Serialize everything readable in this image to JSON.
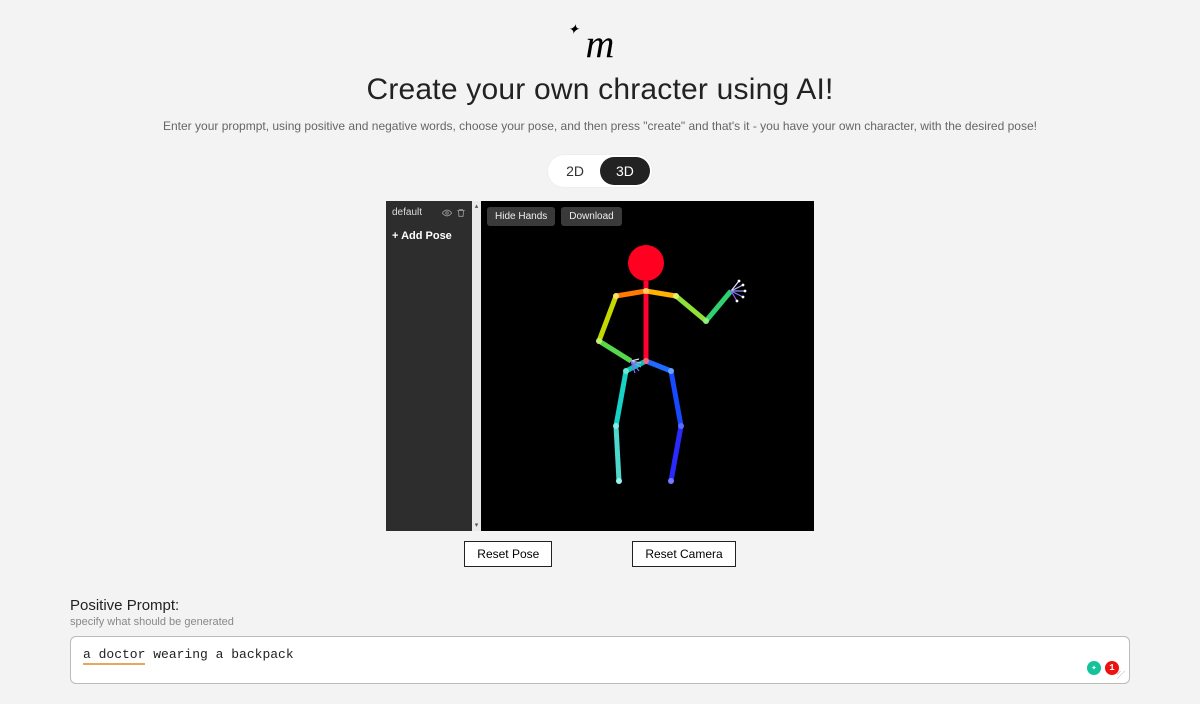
{
  "logo_text": "m",
  "title": "Create your own chracter using AI!",
  "subtitle": "Enter your propmpt, using positive and negative words, choose your pose, and then press \"create\" and that's it - you have your own character, with the desired pose!",
  "toggle": {
    "option_2d": "2D",
    "option_3d": "3D",
    "active": "3D"
  },
  "sidebar": {
    "pose_name": "default",
    "add_pose": "+  Add Pose"
  },
  "viewport_buttons": {
    "hide_hands": "Hide Hands",
    "download": "Download"
  },
  "reset": {
    "pose": "Reset Pose",
    "camera": "Reset Camera"
  },
  "prompt": {
    "label": "Positive Prompt:",
    "hint": "specify what should be generated",
    "value_underlined": "a doctor",
    "value_rest": " wearing a backpack"
  },
  "grammarly_count": "1"
}
